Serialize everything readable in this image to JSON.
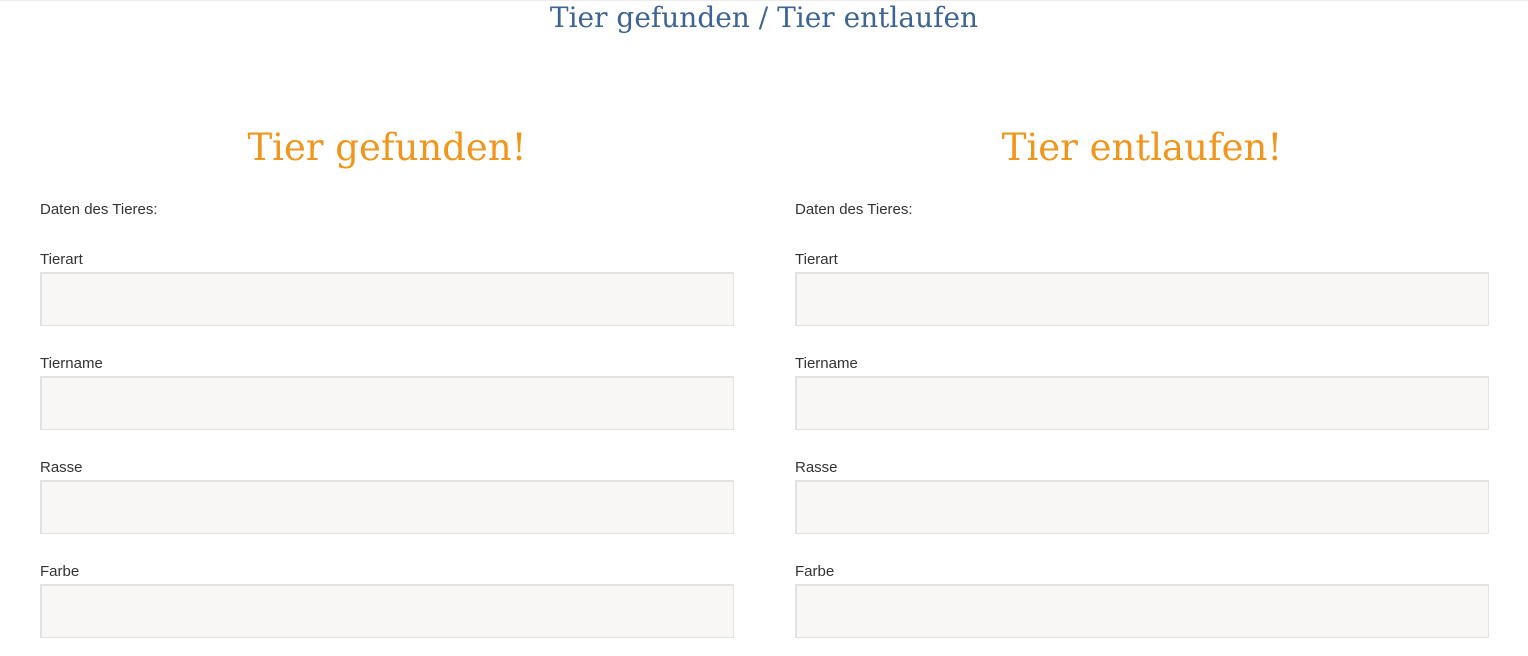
{
  "page": {
    "title": "Tier gefunden / Tier entlaufen"
  },
  "found_form": {
    "heading": "Tier gefunden!",
    "intro": "Daten des Tieres:",
    "fields": [
      {
        "label": "Tierart",
        "value": ""
      },
      {
        "label": "Tiername",
        "value": ""
      },
      {
        "label": "Rasse",
        "value": ""
      },
      {
        "label": "Farbe",
        "value": ""
      }
    ]
  },
  "lost_form": {
    "heading": "Tier entlaufen!",
    "intro": "Daten des Tieres:",
    "fields": [
      {
        "label": "Tierart",
        "value": ""
      },
      {
        "label": "Tiername",
        "value": ""
      },
      {
        "label": "Rasse",
        "value": ""
      },
      {
        "label": "Farbe",
        "value": ""
      }
    ]
  },
  "colors": {
    "title": "#3d6494",
    "section_heading": "#f0961d",
    "input_background": "#f8f7f6"
  }
}
